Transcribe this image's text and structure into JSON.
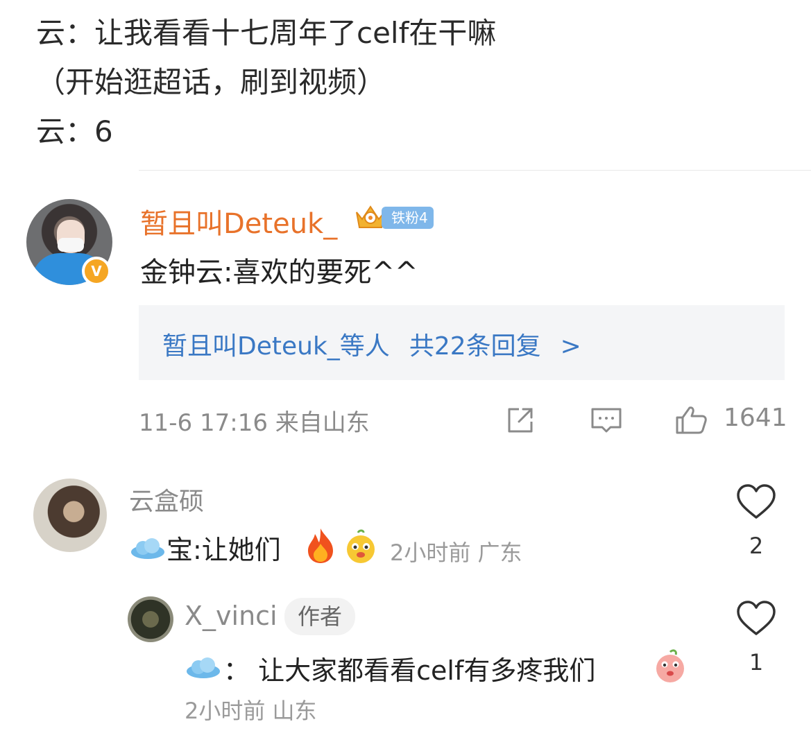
{
  "post": {
    "lines": [
      "云：让我看看十七周年了celf在干嘛",
      "（开始逛超话，刷到视频）",
      "云：6"
    ]
  },
  "main_comment": {
    "username": "暂且叫Deteuk_",
    "fan_badge": "铁粉4",
    "verified_mark": "V",
    "text": "金钟云:喜欢的要死^^",
    "reply_summary": {
      "who": "暂且叫Deteuk_等人",
      "count_text": "共22条回复",
      "arrow": ">"
    },
    "timestamp": "11-6 17:16",
    "location": "来自山东",
    "like_count": "1641",
    "icons": [
      "share-icon",
      "comment-icon",
      "like-icon"
    ]
  },
  "sub_comments": [
    {
      "username": "云盒硕",
      "text": "宝:让她们",
      "time": "2小时前",
      "location": "广东",
      "like_count": "2"
    },
    {
      "username": "X_vinci",
      "author_tag": "作者",
      "prefix": "：",
      "text": "让大家都看看celf有多疼我们",
      "time": "2小时前",
      "location": "山东",
      "like_count": "1"
    }
  ],
  "colors": {
    "username_orange": "#e8722a",
    "link_blue": "#3a78c4",
    "meta_gray": "#8a8a8a",
    "reply_bg": "#f4f5f7"
  }
}
